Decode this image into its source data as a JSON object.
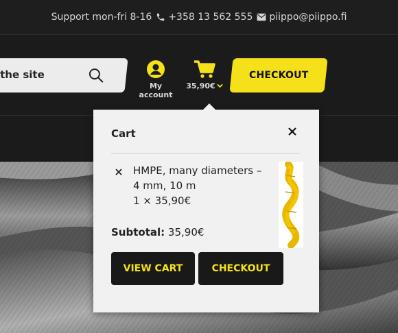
{
  "topbar": {
    "support": "Support mon-fri 8-16",
    "phone": "+358 13 562 555",
    "email": "piippo@piippo.fi"
  },
  "header": {
    "search_text": "the site",
    "account_label": "My account",
    "cart_amount": "35,90€",
    "checkout_label": "CHECKOUT"
  },
  "cart_popup": {
    "title": "Cart",
    "item": {
      "name": "HMPE, many diameters – 4 mm, 10 m",
      "quantity_price": "1 × 35,90€"
    },
    "subtotal_label": "Subtotal:",
    "subtotal_value": "35,90€",
    "view_cart_label": "VIEW CART",
    "checkout_label": "CHECKOUT"
  },
  "colors": {
    "accent_yellow": "#f5e11a",
    "dark_bg": "#1b1b1b",
    "popup_bg": "#f1f1f1"
  },
  "icons": [
    "phone-icon",
    "mail-icon",
    "search-icon",
    "account-icon",
    "cart-icon",
    "chevron-down-icon",
    "close-icon",
    "remove-icon"
  ]
}
